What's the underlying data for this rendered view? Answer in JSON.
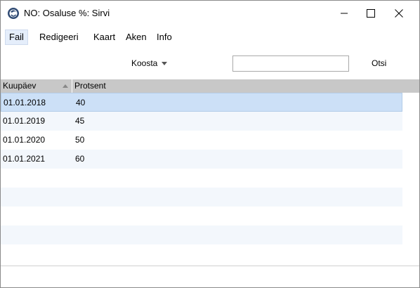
{
  "window": {
    "title": "NO: Osaluse %: Sirvi"
  },
  "menu": {
    "items": [
      "Fail",
      "Redigeeri",
      "Kaart",
      "Aken",
      "Info"
    ]
  },
  "toolbar": {
    "koosta_label": "Koosta",
    "search_value": "",
    "search_button_label": "Otsi"
  },
  "table": {
    "columns": [
      "Kuupäev",
      "Protsent"
    ],
    "sort": {
      "column": "Kuupäev",
      "direction": "ascending"
    },
    "rows": [
      {
        "date": "01.01.2018",
        "percent": "40"
      },
      {
        "date": "01.01.2019",
        "percent": "45"
      },
      {
        "date": "01.01.2020",
        "percent": "50"
      },
      {
        "date": "01.01.2021",
        "percent": "60"
      }
    ],
    "selected_row": 0
  },
  "colors": {
    "header_bg": "#c8c8c8",
    "selected_row_bg": "#cce0f7",
    "alt_row_bg": "#f3f7fc",
    "menu_active_bg": "#e5eefb"
  },
  "icons": {
    "app": "app-logo-icon",
    "minimize": "minimize-icon",
    "maximize": "maximize-icon",
    "close": "close-icon",
    "dropdown": "chevron-down-icon",
    "sort": "sort-ascending-icon"
  }
}
